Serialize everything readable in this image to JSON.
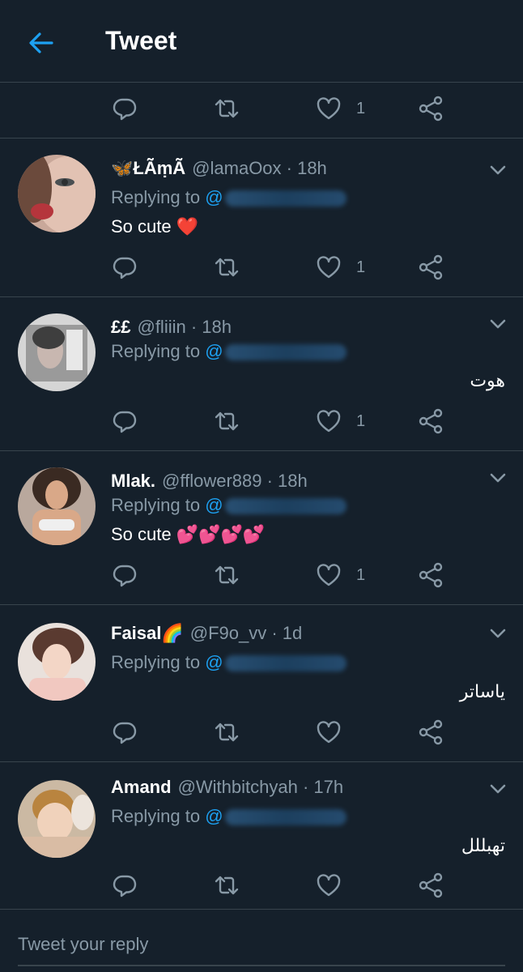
{
  "header": {
    "title": "Tweet"
  },
  "top_actions": {
    "like_count": "1"
  },
  "tweets": [
    {
      "name": "🦋ŁÃ̃ṃÃ̃",
      "handle": "@lamaOox · 18h",
      "replying_label": "Replying to",
      "mention_prefix": "@",
      "body": "So cute ❤️",
      "like_count": "1"
    },
    {
      "name": "££",
      "handle": "@fliiin · 18h",
      "replying_label": "Replying to",
      "mention_prefix": "@",
      "body": "هوت",
      "like_count": "1"
    },
    {
      "name": "Mlak.",
      "handle": "@fflower889 · 18h",
      "replying_label": "Replying to",
      "mention_prefix": "@",
      "body": "So cute 💕💕💕💕",
      "like_count": "1"
    },
    {
      "name": "Faisal🌈",
      "handle": "@F9o_vv · 1d",
      "replying_label": "Replying to",
      "mention_prefix": "@",
      "body": "ياساتر",
      "like_count": ""
    },
    {
      "name": "Amand",
      "handle": "@Withbitchyah · 17h",
      "replying_label": "Replying to",
      "mention_prefix": "@",
      "body": "تهبللل",
      "like_count": ""
    }
  ],
  "reply_box": {
    "placeholder": "Tweet your reply"
  },
  "colors": {
    "accent": "#1da1f2",
    "background": "#15202b",
    "muted": "#8899a6",
    "divider": "#38444d"
  }
}
